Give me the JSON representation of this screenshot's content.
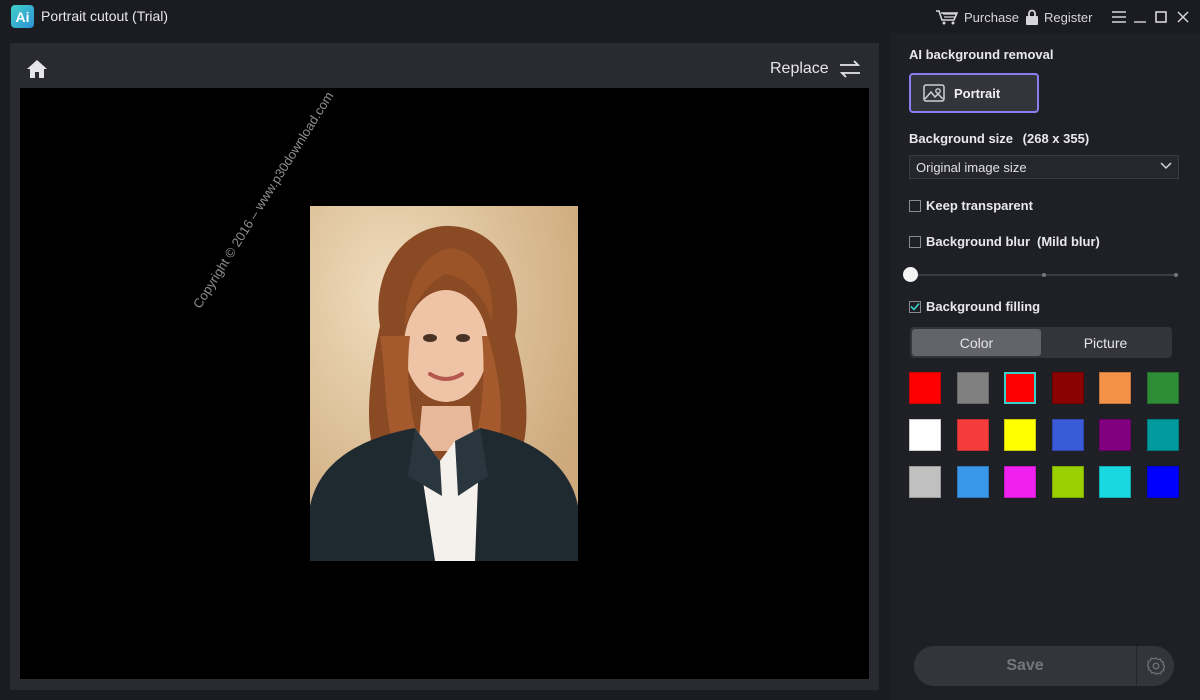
{
  "window": {
    "title": "Portrait cutout (Trial)",
    "logo_text": "Ai",
    "purchase_label": "Purchase",
    "register_label": "Register"
  },
  "workspace": {
    "replace_label": "Replace",
    "watermark": "Copyright © 2016 – www.p30download.com"
  },
  "panel": {
    "removal_title": "AI background removal",
    "portrait_label": "Portrait",
    "bg_size_label": "Background size",
    "bg_size_dims": "(268 x 355)",
    "size_dropdown_value": "Original image size",
    "keep_transparent_label": "Keep transparent",
    "keep_transparent_checked": false,
    "bg_blur_label": "Background blur",
    "bg_blur_level": "(Mild blur)",
    "bg_blur_checked": false,
    "blur_slider_value": 0,
    "bg_filling_label": "Background filling",
    "bg_filling_checked": true,
    "fill_tabs": [
      "Color",
      "Picture"
    ],
    "active_fill_tab": "Color",
    "swatches": [
      "#ff0000",
      "#808080",
      "#ff0000",
      "#8b0000",
      "#f5924a",
      "#2e8b36",
      "#ffffff",
      "#f53c3c",
      "#ffff00",
      "#3a5bd8",
      "#800080",
      "#00999c",
      "#c0c0c0",
      "#3a96e8",
      "#f020f0",
      "#9ad000",
      "#1ad8e0",
      "#0000ff"
    ],
    "selected_swatch_index": 2,
    "save_label": "Save"
  },
  "colors": {
    "accent": "#8d7cf0",
    "selection": "#3ad0c8"
  }
}
